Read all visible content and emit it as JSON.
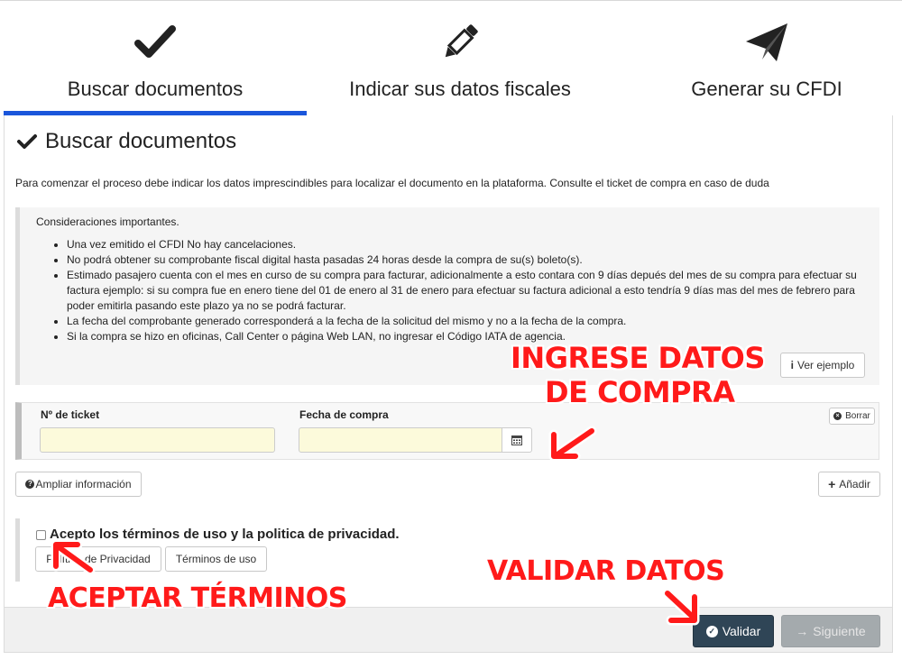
{
  "steps": [
    {
      "label": "Buscar documentos",
      "icon": "check-icon",
      "active": true
    },
    {
      "label": "Indicar sus datos fiscales",
      "icon": "pencil-icon",
      "active": false
    },
    {
      "label": "Generar su CFDI",
      "icon": "paper-plane-icon",
      "active": false
    }
  ],
  "section": {
    "title": "Buscar documentos",
    "intro": "Para comenzar el proceso debe indicar los datos imprescindibles para localizar el documento en la plataforma. Consulte el ticket de compra en caso de duda"
  },
  "notes": {
    "title": "Consideraciones importantes.",
    "items": [
      "Una vez emitido el CFDI No hay cancelaciones.",
      "No podrá obtener su comprobante fiscal digital hasta pasadas 24 horas desde la compra de su(s) boleto(s).",
      "Estimado pasajero cuenta con el mes en curso de su compra para facturar, adicionalmente a esto contara con 9 días depués del mes de su compra para efectuar su factura ejemplo: si su compra fue en enero tiene del 01 de enero al 31 de enero para efectuar su factura adicional a esto tendría 9 días mas del mes de febrero para poder emitirla pasando este plazo ya no se podrá facturar.",
      "La fecha del comprobante generado corresponderá a la fecha de la solicitud del mismo y no a la fecha de la compra.",
      "Si la compra se hizo en oficinas, Call Center o página Web LAN, no ingresar el Código IATA de agencia."
    ],
    "example_button": "Ver ejemplo"
  },
  "form": {
    "ticket_label": "Nº de ticket",
    "ticket_value": "",
    "date_label": "Fecha de compra",
    "date_value": "",
    "clear_button": "Borrar"
  },
  "actions": {
    "more_info": "Ampliar información",
    "add": "Añadir"
  },
  "terms": {
    "label": "Acepto los términos de uso y la politica de privacidad.",
    "privacy_button": "Política de Privacidad",
    "terms_button": "Términos de uso",
    "checked": false
  },
  "footer": {
    "validate": "Validar",
    "next": "Siguiente"
  },
  "annotations": {
    "ingrese_line1": "INGRESE DATOS",
    "ingrese_line2": "DE COMPRA",
    "validar": "VALIDAR DATOS",
    "aceptar": "ACEPTAR TÉRMINOS",
    "color": "#ff1a1a"
  },
  "colors": {
    "active_step": "#1a56db",
    "primary_button": "#2f4556",
    "input_bg": "#fcfadb"
  }
}
